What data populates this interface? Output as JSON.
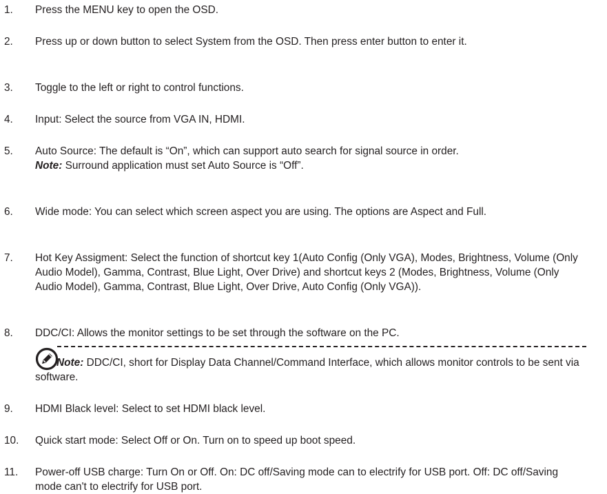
{
  "items": [
    {
      "num": "1.",
      "text": "Press the MENU key to open the OSD."
    },
    {
      "num": "2.",
      "text": "Press up or down button to select System from the OSD. Then press enter button to enter it."
    },
    {
      "num": "3.",
      "text": "Toggle to the left or right to control functions."
    },
    {
      "num": "4.",
      "text": "Input: Select the source from VGA IN, HDMI."
    },
    {
      "num": "5.",
      "text": "Auto Source: The default is “On”, which can support auto search for signal source in order.",
      "note_label": "Note:",
      "note_text": " Surround application must set Auto Source is “Off”."
    },
    {
      "num": "6.",
      "text": "Wide mode: You can select which screen aspect you are using. The options are Aspect and Full."
    },
    {
      "num": "7.",
      "text": "Hot Key Assigment: Select the function of shortcut key 1(Auto Config (Only VGA), Modes, Brightness, Volume (Only Audio Model), Gamma, Contrast, Blue Light, Over Drive) and shortcut keys 2 (Modes, Brightness, Volume (Only Audio Model), Gamma, Contrast, Blue Light, Over Drive, Auto Config (Only VGA))."
    },
    {
      "num": "8.",
      "text": "DDC/CI: Allows the monitor settings to be set through the software on the PC."
    },
    {
      "num": "9.",
      "text": "HDMI Black level: Select to set HDMI black level."
    },
    {
      "num": "10.",
      "text": "Quick start mode: Select Off or On. Turn on to speed up boot speed."
    },
    {
      "num": "11.",
      "text": "Power-off USB charge: Turn On or Off. On: DC off/Saving mode can to electrify for USB port. Off: DC off/Saving mode can't to electrify for USB port."
    }
  ],
  "callout": {
    "icon": "note-pen-icon",
    "label": "Note:",
    "text": " DDC/CI, short for Display Data Channel/Command Interface, which allows monitor controls to be sent via software."
  }
}
